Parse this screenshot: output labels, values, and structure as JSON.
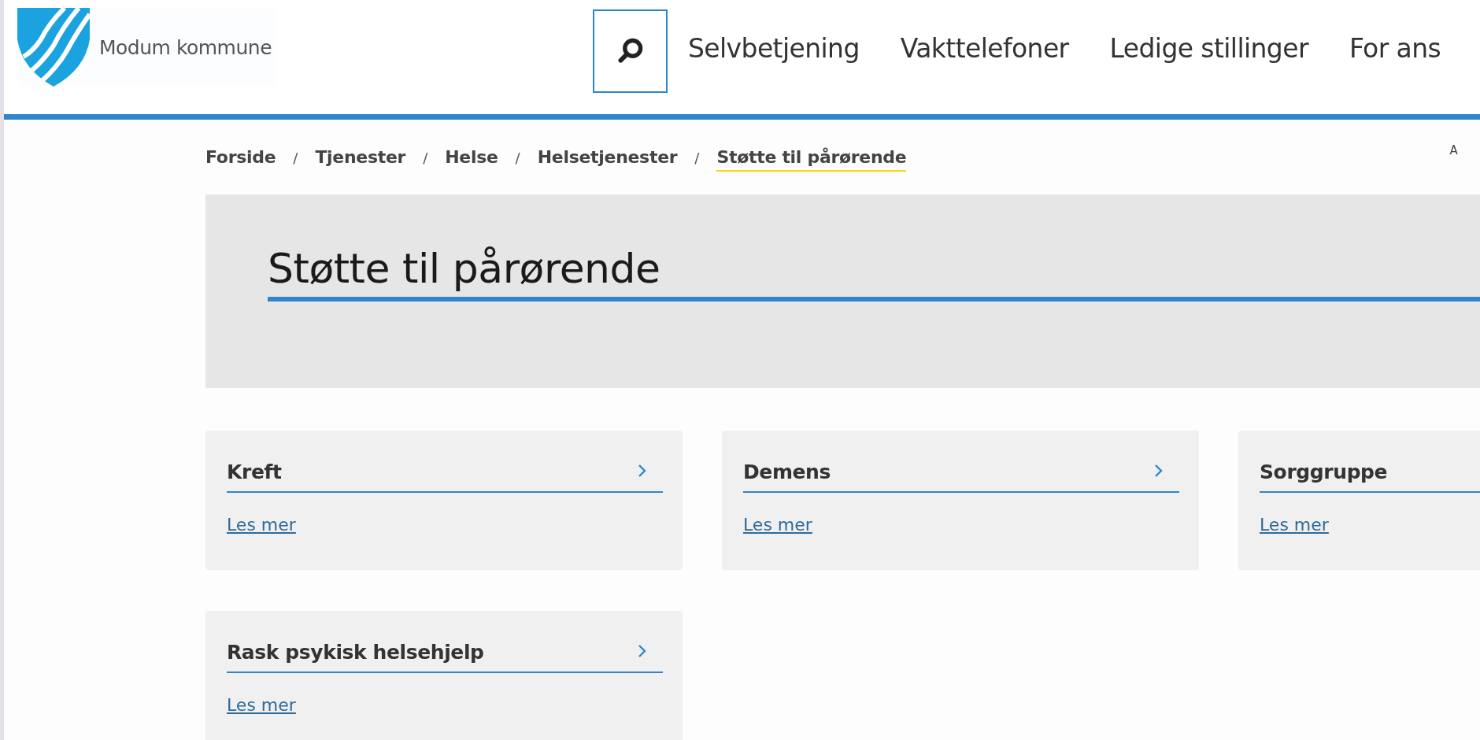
{
  "header": {
    "logo_text": "Modum kommune",
    "nav": [
      "Selvbetjening",
      "Vakttelefoner",
      "Ledige stillinger",
      "For ans"
    ]
  },
  "breadcrumbs": [
    {
      "label": "Forside",
      "selected": false
    },
    {
      "label": "Tjenester",
      "selected": false
    },
    {
      "label": "Helse",
      "selected": false
    },
    {
      "label": "Helsetjenester",
      "selected": false
    },
    {
      "label": "Støtte til pårørende",
      "selected": true
    }
  ],
  "breadcrumb_separator": "/",
  "corner_text": "A",
  "page_title": "Støtte til pårørende",
  "cards": [
    {
      "title": "Kreft",
      "link": "Les mer"
    },
    {
      "title": "Demens",
      "link": "Les mer"
    },
    {
      "title": "Sorggruppe",
      "link": "Les mer"
    },
    {
      "title": "Rask psykisk helsehjelp",
      "link": "Les mer"
    }
  ]
}
